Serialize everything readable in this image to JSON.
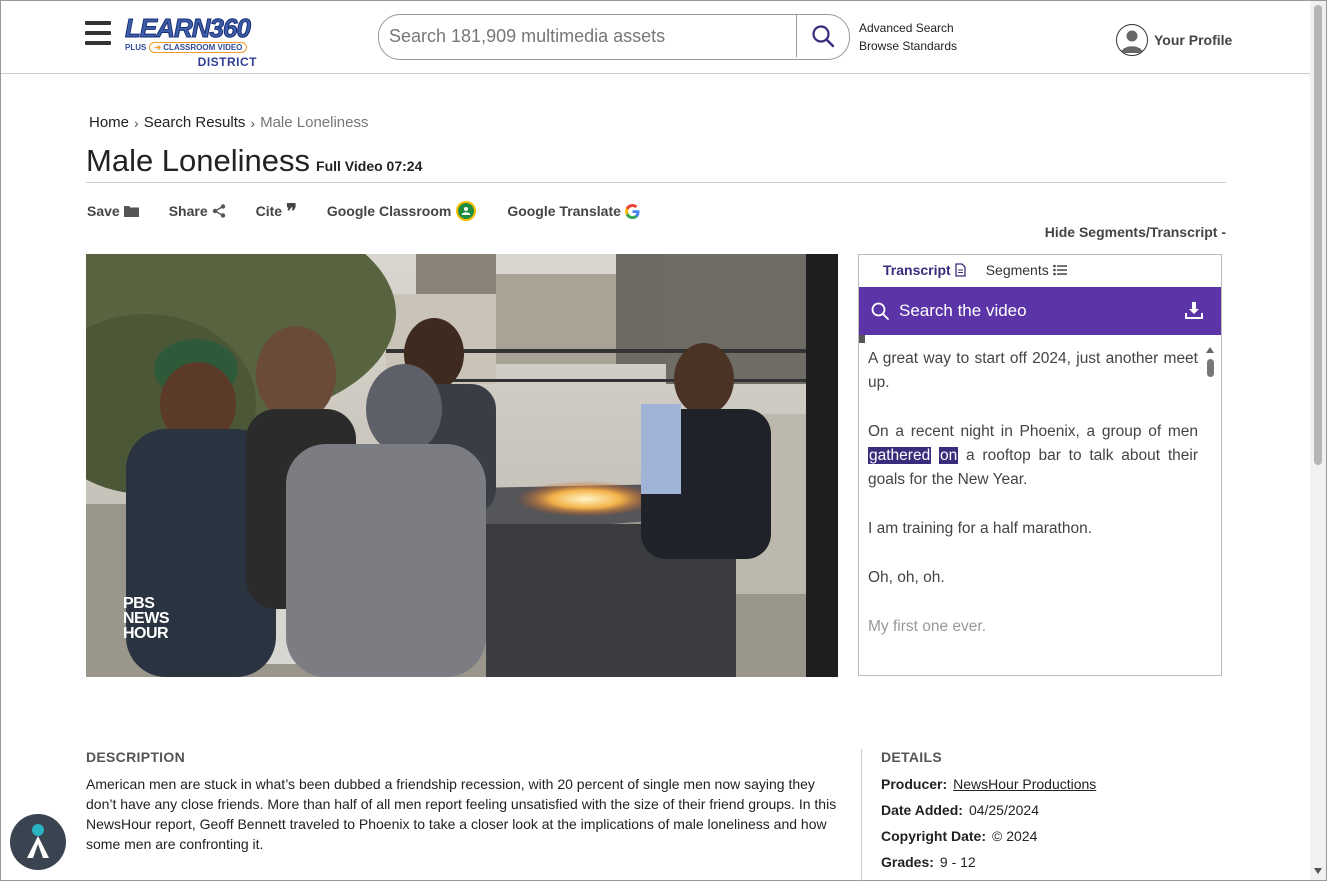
{
  "header": {
    "logo_main": "LEARN360",
    "logo_plus": "PLUS",
    "logo_pill": "CLASSROOM VIDEO",
    "logo_district": "DISTRICT",
    "search_placeholder": "Search 181,909 multimedia assets",
    "advanced_search": "Advanced Search",
    "browse_standards": "Browse Standards",
    "profile_label": "Your Profile"
  },
  "breadcrumb": {
    "home": "Home",
    "results": "Search Results",
    "current": "Male Loneliness"
  },
  "title": {
    "text": "Male Loneliness",
    "meta": "Full Video 07:24"
  },
  "actions": {
    "save": "Save",
    "share": "Share",
    "cite": "Cite",
    "google_classroom": "Google Classroom",
    "google_translate": "Google Translate"
  },
  "hide_segments": "Hide Segments/Transcript -",
  "video": {
    "watermark_1": "PBS",
    "watermark_2": "NEWS",
    "watermark_3": "HOUR"
  },
  "panel": {
    "tab_transcript": "Transcript",
    "tab_segments": "Segments",
    "search_label": "Search the video",
    "lines": {
      "l1": "A great way to start off 2024, just another meet up.",
      "l2_pre": "On a recent night in Phoenix, a group of men ",
      "l2_hl1": "gathered",
      "l2_hl2": "on",
      "l2_post": " a rooftop bar to talk about their goals for the New Year.",
      "l3": "I am training for a half marathon.",
      "l4": "Oh, oh, oh.",
      "l5": "My first one ever."
    }
  },
  "description": {
    "heading": "DESCRIPTION",
    "text": "American men are stuck in what’s been dubbed a friendship recession, with 20 percent of single men now saying they don’t have any close friends. More than half of all men report feeling unsatisfied with the size of their friend groups. In this NewsHour report, Geoff Bennett traveled to Phoenix to take a closer look at the implications of male loneliness and how some men are confronting it."
  },
  "details": {
    "heading": "DETAILS",
    "producer_label": "Producer:",
    "producer_value": "NewsHour Productions",
    "date_label": "Date Added:",
    "date_value": "04/25/2024",
    "copyright_label": "Copyright Date:",
    "copyright_value": "© 2024",
    "grades_label": "Grades:",
    "grades_value": "9 - 12"
  },
  "colors": {
    "accent_purple": "#5b34a8",
    "highlight_purple": "#3b2b7c",
    "logo_blue": "#3d5fa8"
  },
  "icons": {
    "menu": "hamburger-icon",
    "search": "search-icon",
    "profile": "user-avatar-icon",
    "save": "folder-icon",
    "share": "share-icon",
    "cite": "quote-icon",
    "classroom": "google-classroom-icon",
    "translate": "google-g-icon",
    "transcript": "document-icon",
    "segments": "list-icon",
    "download": "download-icon",
    "accessibility": "accessibility-icon"
  }
}
